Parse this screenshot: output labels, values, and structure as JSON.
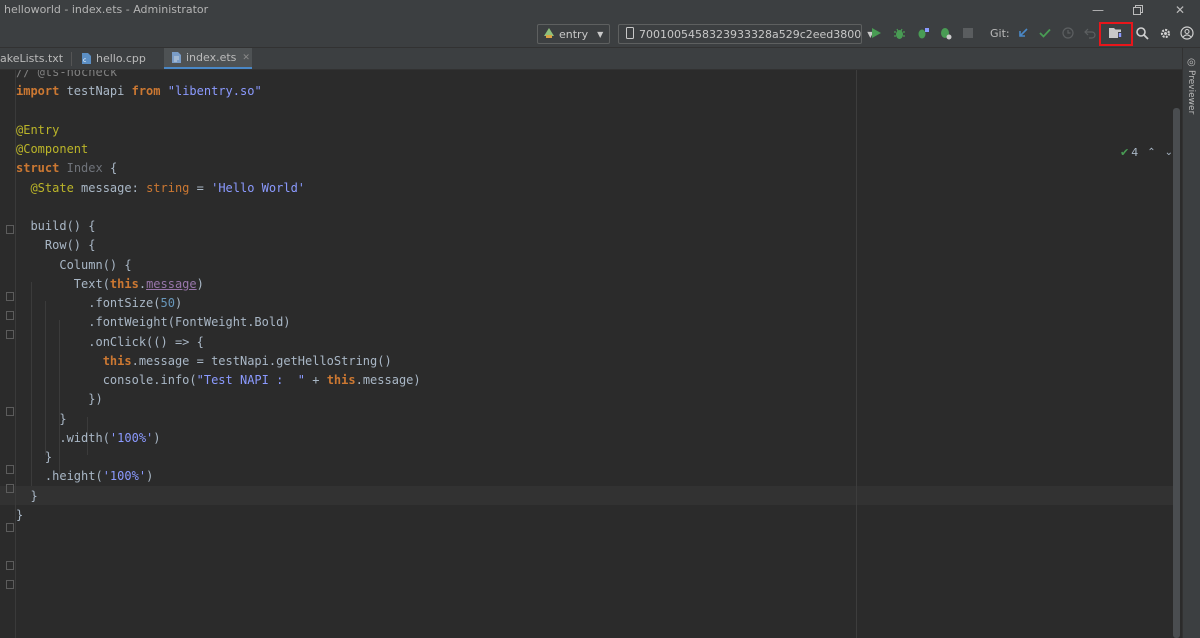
{
  "window": {
    "title": "helloworld - index.ets - Administrator",
    "controls": [
      "minimize-icon",
      "restore-icon",
      "close-icon"
    ]
  },
  "toolbar": {
    "module_selector": "entry",
    "device_selector": "7001005458323933328a529c2eed3800",
    "git_label": "Git:",
    "icons": [
      "run-icon",
      "debug-icon",
      "attach-debugger-icon",
      "stop-icon",
      "git-update-icon",
      "git-commit-icon",
      "git-history-icon",
      "git-rollback-icon",
      "device-manager-icon",
      "search-icon",
      "settings-icon",
      "account-icon"
    ]
  },
  "tabs": [
    {
      "label": "akeLists.txt",
      "active": false
    },
    {
      "label": "hello.cpp",
      "active": false
    },
    {
      "label": "index.ets",
      "active": true
    }
  ],
  "editor": {
    "inspection_count": "4",
    "code_lines": [
      "// @ts-nocheck",
      "import testNapi from \"libentry.so\"",
      "",
      "@Entry",
      "@Component",
      "struct Index {",
      "  @State message: string = 'Hello World'",
      "",
      "  build() {",
      "    Row() {",
      "      Column() {",
      "        Text(this.message)",
      "          .fontSize(50)",
      "          .fontWeight(FontWeight.Bold)",
      "          .onClick(() => {",
      "            this.message = testNapi.getHelloString()",
      "            console.info(\"Test NAPI :  \" + this.message)",
      "          })",
      "      }",
      "      .width('100%')",
      "    }",
      "    .height('100%')",
      "  }",
      "}"
    ]
  },
  "sidebar": {
    "previewer_label": "Previewer"
  },
  "colors": {
    "highlight_box": "#e8161b",
    "editor_bg": "#2b2b2b",
    "toolbar_bg": "#3c3f41"
  }
}
